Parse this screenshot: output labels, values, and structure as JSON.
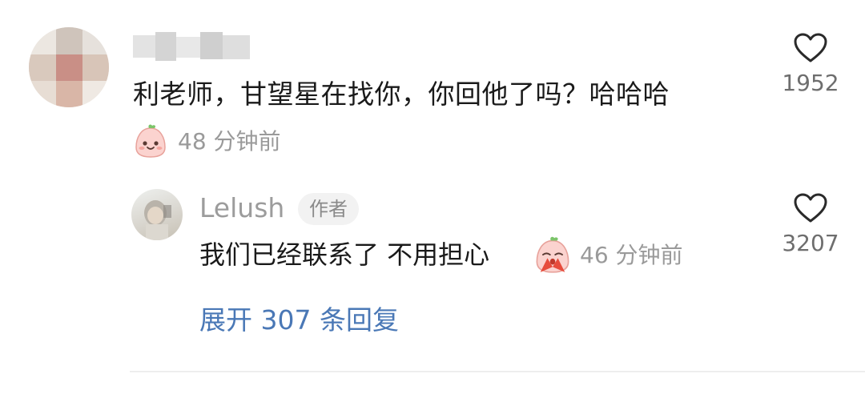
{
  "comment": {
    "username": "",
    "text": "利老师，甘望星在找你，你回他了吗？哈哈哈",
    "emoji": "smile-face-emoji",
    "time": "48 分钟前",
    "like_icon": "heart-outline-icon",
    "like_count": "1952"
  },
  "reply": {
    "username": "Lelush",
    "badge": "作者",
    "text": "我们已经联系了 不用担心",
    "emoji": "pray-face-emoji",
    "time": "46 分钟前",
    "like_icon": "heart-outline-icon",
    "like_count": "3207"
  },
  "expand_replies": {
    "label": "展开 307 条回复"
  },
  "colors": {
    "text_primary": "#1a1a1a",
    "text_secondary": "#9a9a9a",
    "link": "#4a78b6",
    "badge_bg": "#f2f2f2",
    "divider": "#eeeeee"
  }
}
